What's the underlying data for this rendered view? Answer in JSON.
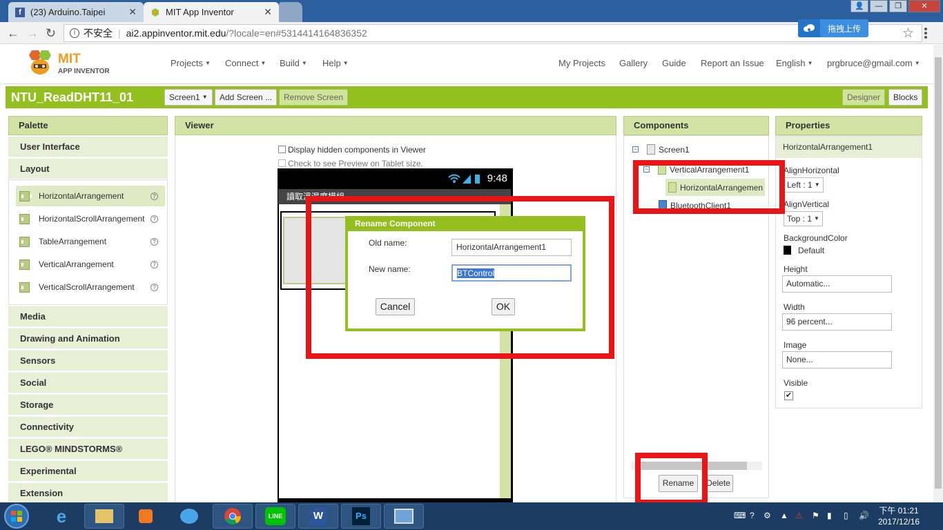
{
  "browser": {
    "tabs": [
      {
        "title": "(23) Arduino.Taipei"
      },
      {
        "title": "MIT App Inventor"
      }
    ],
    "security_label": "不安全",
    "url_host": "ai2.appinventor.mit.edu",
    "url_path": "/?locale=en#5314414164836352",
    "upload_label": "拖拽上传"
  },
  "header": {
    "logo_mit": "MIT",
    "logo_sub": "APP INVENTOR",
    "menus": [
      "Projects",
      "Connect",
      "Build",
      "Help"
    ],
    "links": [
      "My Projects",
      "Gallery",
      "Guide",
      "Report an Issue",
      "English",
      "prgbruce@gmail.com"
    ]
  },
  "project": {
    "name": "NTU_ReadDHT11_01",
    "screen_select": "Screen1",
    "add_screen": "Add Screen ...",
    "remove_screen": "Remove Screen",
    "designer": "Designer",
    "blocks": "Blocks"
  },
  "palette": {
    "title": "Palette",
    "categories_top": [
      "User Interface",
      "Layout"
    ],
    "layout_items": [
      "HorizontalArrangement",
      "HorizontalScrollArrangement",
      "TableArrangement",
      "VerticalArrangement",
      "VerticalScrollArrangement"
    ],
    "categories_bottom": [
      "Media",
      "Drawing and Animation",
      "Sensors",
      "Social",
      "Storage",
      "Connectivity",
      "LEGO® MINDSTORMS®",
      "Experimental",
      "Extension"
    ]
  },
  "viewer": {
    "title": "Viewer",
    "hidden_components": "Display hidden components in Viewer",
    "tablet_preview": "Check to see Preview on Tablet size.",
    "phone_time": "9:48",
    "phone_title": "讀取溫濕度模組"
  },
  "dialog": {
    "title": "Rename Component",
    "old_label": "Old name:",
    "old_value": "HorizontalArrangement1",
    "new_label": "New name:",
    "new_value": "BTControl",
    "cancel": "Cancel",
    "ok": "OK"
  },
  "components": {
    "title": "Components",
    "tree": [
      "Screen1",
      "VerticalArrangement1",
      "HorizontalArrangemen",
      "BluetoothClient1"
    ],
    "rename": "Rename",
    "delete": "Delete"
  },
  "properties": {
    "title": "Properties",
    "component": "HorizontalArrangement1",
    "align_h_label": "AlignHorizontal",
    "align_h_value": "Left : 1",
    "align_v_label": "AlignVertical",
    "align_v_value": "Top : 1",
    "bg_label": "BackgroundColor",
    "bg_value": "Default",
    "height_label": "Height",
    "height_value": "Automatic...",
    "width_label": "Width",
    "width_value": "96 percent...",
    "image_label": "Image",
    "image_value": "None...",
    "visible_label": "Visible"
  },
  "taskbar": {
    "clock_time": "下午 01:21",
    "clock_date": "2017/12/16"
  }
}
